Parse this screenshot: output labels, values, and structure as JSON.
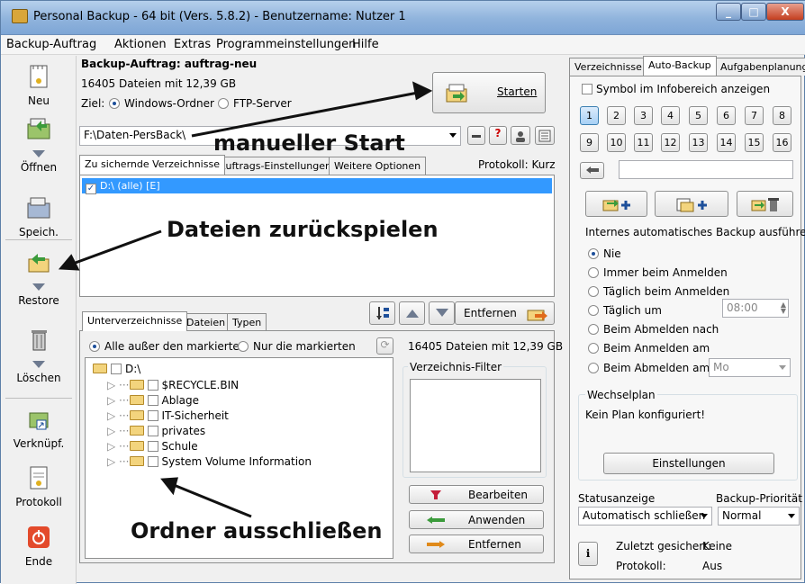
{
  "window": {
    "title": "Personal Backup - 64 bit (Vers. 5.8.2) - Benutzername: Nutzer 1",
    "minimize": "_",
    "maximize": "□",
    "close": "X"
  },
  "menu": [
    "Backup-Auftrag",
    "Aktionen",
    "Extras",
    "Programmeinstellungen",
    "Hilfe"
  ],
  "toolbar": {
    "new": "Neu",
    "open": "Öffnen",
    "save": "Speich.",
    "restore": "Restore",
    "delete": "Löschen",
    "link": "Verknüpf.",
    "log": "Protokoll",
    "exit": "Ende"
  },
  "job": {
    "title": "Backup-Auftrag: auftrag-neu",
    "summary": "16405 Dateien mit 12,39 GB",
    "target_label": "Ziel:",
    "target_windows": "Windows-Ordner",
    "target_ftp": "FTP-Server",
    "start_button": "Starten",
    "path": "F:\\Daten-PersBack\\",
    "log_label": "Protokoll: Kurz"
  },
  "tabs_main": [
    "Zu sichernde Verzeichnisse",
    "Auftrags-Einstellungen",
    "Weitere Optionen"
  ],
  "dir_list": [
    {
      "label": "D:\\ (alle) [E]",
      "checked": true
    }
  ],
  "remove_button": "Entfernen",
  "tabs_sub": [
    "Unterverzeichnisse",
    "Dateien",
    "Typen"
  ],
  "sub": {
    "all_except": "Alle außer den markierten",
    "only_marked": "Nur die markierten",
    "summary": "16405 Dateien mit 12,39 GB",
    "filter_label": "Verzeichnis-Filter",
    "root": "D:\\",
    "folders": [
      "$RECYCLE.BIN",
      "Ablage",
      "IT-Sicherheit",
      "privates",
      "Schule",
      "System Volume Information"
    ],
    "edit": "Bearbeiten",
    "apply": "Anwenden",
    "remove": "Entfernen"
  },
  "right_tabs": [
    "Verzeichnisse",
    "Auto-Backup",
    "Aufgabenplanung"
  ],
  "auto": {
    "tray_icon": "Symbol im Infobereich anzeigen",
    "numbers": [
      "1",
      "2",
      "3",
      "4",
      "5",
      "6",
      "7",
      "8",
      "9",
      "10",
      "11",
      "12",
      "13",
      "14",
      "15",
      "16"
    ],
    "internal_label": "Internes automatisches Backup ausführen",
    "options": [
      "Nie",
      "Immer beim Anmelden",
      "Täglich beim Anmelden",
      "Täglich um",
      "Beim Abmelden nach",
      "Beim Anmelden am",
      "Beim Abmelden am"
    ],
    "time": "08:00",
    "day": "Mo",
    "rotation_label": "Wechselplan",
    "rotation_value": "Kein Plan konfiguriert!",
    "settings_button": "Einstellungen",
    "status_label": "Statusanzeige",
    "priority_label": "Backup-Priorität",
    "status_value": "Automatisch schließen",
    "priority_value": "Normal",
    "last_saved_label": "Zuletzt gesichert:",
    "last_saved_value": "Keine",
    "log_label": "Protokoll:",
    "log_value": "Aus"
  },
  "annotations": {
    "manual_start": "manueller Start",
    "restore_files": "Dateien zurückspielen",
    "exclude_folders": "Ordner ausschließen"
  },
  "colors": {
    "selection": "#3399ff",
    "title_bar": "#9cbde3"
  }
}
